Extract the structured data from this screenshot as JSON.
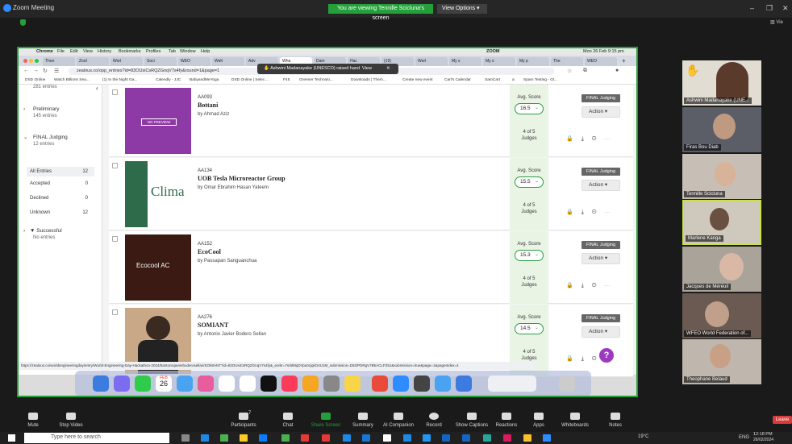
{
  "zoom": {
    "window_title": "Zoom Meeting",
    "share_banner": "You are viewing Tennille Scicluna's screen",
    "view_options": "View Options ▾",
    "view_label": "▥ Vie",
    "minimize": "–",
    "maximize": "❐",
    "close": "✕"
  },
  "mac_menu": {
    "apple": "",
    "items": [
      "Chrome",
      "File",
      "Edit",
      "View",
      "History",
      "Bookmarks",
      "Profiles",
      "Tab",
      "Window",
      "Help"
    ],
    "right": "ZOOM",
    "datetime": "Mon 26 Feb 9:15 pm"
  },
  "tabs": [
    {
      "label": "Then",
      "active": false
    },
    {
      "label": "Zool",
      "active": false
    },
    {
      "label": "Worl",
      "active": false
    },
    {
      "label": "Soci",
      "active": false
    },
    {
      "label": "WEO",
      "active": false
    },
    {
      "label": "Welt",
      "active": false
    },
    {
      "label": "Adv",
      "active": false
    },
    {
      "label": "Wha",
      "active": true
    },
    {
      "label": "Dam",
      "active": false
    },
    {
      "label": "Hac",
      "active": false
    },
    {
      "label": "(19)",
      "active": false
    },
    {
      "label": "Worl",
      "active": false
    },
    {
      "label": "My s",
      "active": false
    },
    {
      "label": "My s",
      "active": false
    },
    {
      "label": "My p",
      "active": false
    },
    {
      "label": "The",
      "active": false
    },
    {
      "label": "WEO",
      "active": false
    }
  ],
  "browser": {
    "url": "zealous.co/opp_entries?id=83OUsiCsRQZGnqV7s4fy&round=1&page=1",
    "raised_hand": "✋ Ashwini Madanayake (UNESCO) raised hand",
    "raised_view": "View",
    "raised_close": "✕",
    "bookmarks": [
      "DSD Online",
      "Watch Billions Sea...",
      "(1) In the Night Ga...",
      "Calendly - JJC",
      "BabyandMeYoga",
      "DSD Online | Selec...",
      "F45",
      "Greener Technolo...",
      "Downloads | Them...",
      "Create new event",
      "Carl's Calendar",
      "SamCart",
      "a",
      "Spam Testing - Gl..."
    ],
    "status_url": "https://zealous.co/worldengineeringday/entry/World-Engineering-Day-Hackathon-2024/5antonisjavierboderosellan/SOMIANT?id=83OUsiCsRQZGnqV7s4fy&_eorkr=7sr5lMqDYpu0cjqkO4U1M_submission=D5OPDRgV7B5ACLFZ51&submission=true&page=1&pageIndex=4"
  },
  "sidebar": {
    "top_count": "281 entries",
    "groups": [
      {
        "title": "Preliminary",
        "count": "145 entries"
      },
      {
        "title": "FINAL Judging",
        "count": "12 entries"
      }
    ],
    "filters": [
      {
        "label": "All Entries",
        "count": "12"
      },
      {
        "label": "Accepted",
        "count": "0"
      },
      {
        "label": "Declined",
        "count": "0"
      },
      {
        "label": "Unknown",
        "count": "12"
      }
    ],
    "successful_title": "▼ Successful",
    "successful_count": "No entries"
  },
  "entries": [
    {
      "id": "AA093",
      "title": "Bottani",
      "by": "by Ahmad Aziz",
      "score": "16.5",
      "judges_count": "4 of 5",
      "judges_label": "Judges",
      "thumb_text": "NO PREVIEW"
    },
    {
      "id": "AA134",
      "title": "UOB Tesla Microreactor Group",
      "by": "by Omar Ebrahim Hasan Yateem",
      "score": "15.5",
      "judges_count": "4 of 5",
      "judges_label": "Judges",
      "thumb_text": "Clima"
    },
    {
      "id": "AA152",
      "title": "EcoCool",
      "by": "by Passapan Sanguanchua",
      "score": "15.3",
      "judges_count": "4 of 5",
      "judges_label": "Judges",
      "thumb_text": "Ecocool AC"
    },
    {
      "id": "AA276",
      "title": "SOMIANT",
      "by": "by Antonio Javier Bodero Sellan",
      "score": "14.5",
      "judges_count": "4 of 5",
      "judges_label": "Judges",
      "thumb_text": ""
    }
  ],
  "entry_labels": {
    "avg_score": "Avg. Score",
    "badge": "FINAL Judging",
    "action": "Action ▾",
    "help": "?"
  },
  "dock": {
    "calendar_month": "FEB",
    "calendar_day": "26"
  },
  "participants": [
    {
      "name": "Ashwini Madanayake (UNE..."
    },
    {
      "name": "Firas Bou Diab"
    },
    {
      "name": "Tennille Scicluna"
    },
    {
      "name": "Marlene Kanga"
    },
    {
      "name": "Jacques de Méréuil"
    },
    {
      "name": "WFEO World Federation of..."
    },
    {
      "name": "Theophane Belaud"
    }
  ],
  "toolbar": {
    "items": [
      {
        "label": "Mute"
      },
      {
        "label": "Stop Video"
      },
      {
        "label": "Participants",
        "count": "7"
      },
      {
        "label": "Chat"
      },
      {
        "label": "Share Screen"
      },
      {
        "label": "Summary"
      },
      {
        "label": "AI Companion"
      },
      {
        "label": "Record"
      },
      {
        "label": "Show Captions"
      },
      {
        "label": "Reactions"
      },
      {
        "label": "Apps"
      },
      {
        "label": "Whiteboards"
      },
      {
        "label": "Notes"
      }
    ],
    "leave": "Leave"
  },
  "taskbar": {
    "search_placeholder": "Type here to search",
    "weather": "19°C",
    "lang": "ENG",
    "time": "12:18 PM",
    "date": "26/02/2024"
  },
  "colors": {
    "zoom_green": "#23a03a",
    "score_green": "#2a9d45",
    "help_purple": "#9b3abf",
    "leave_red": "#d73b3b"
  }
}
